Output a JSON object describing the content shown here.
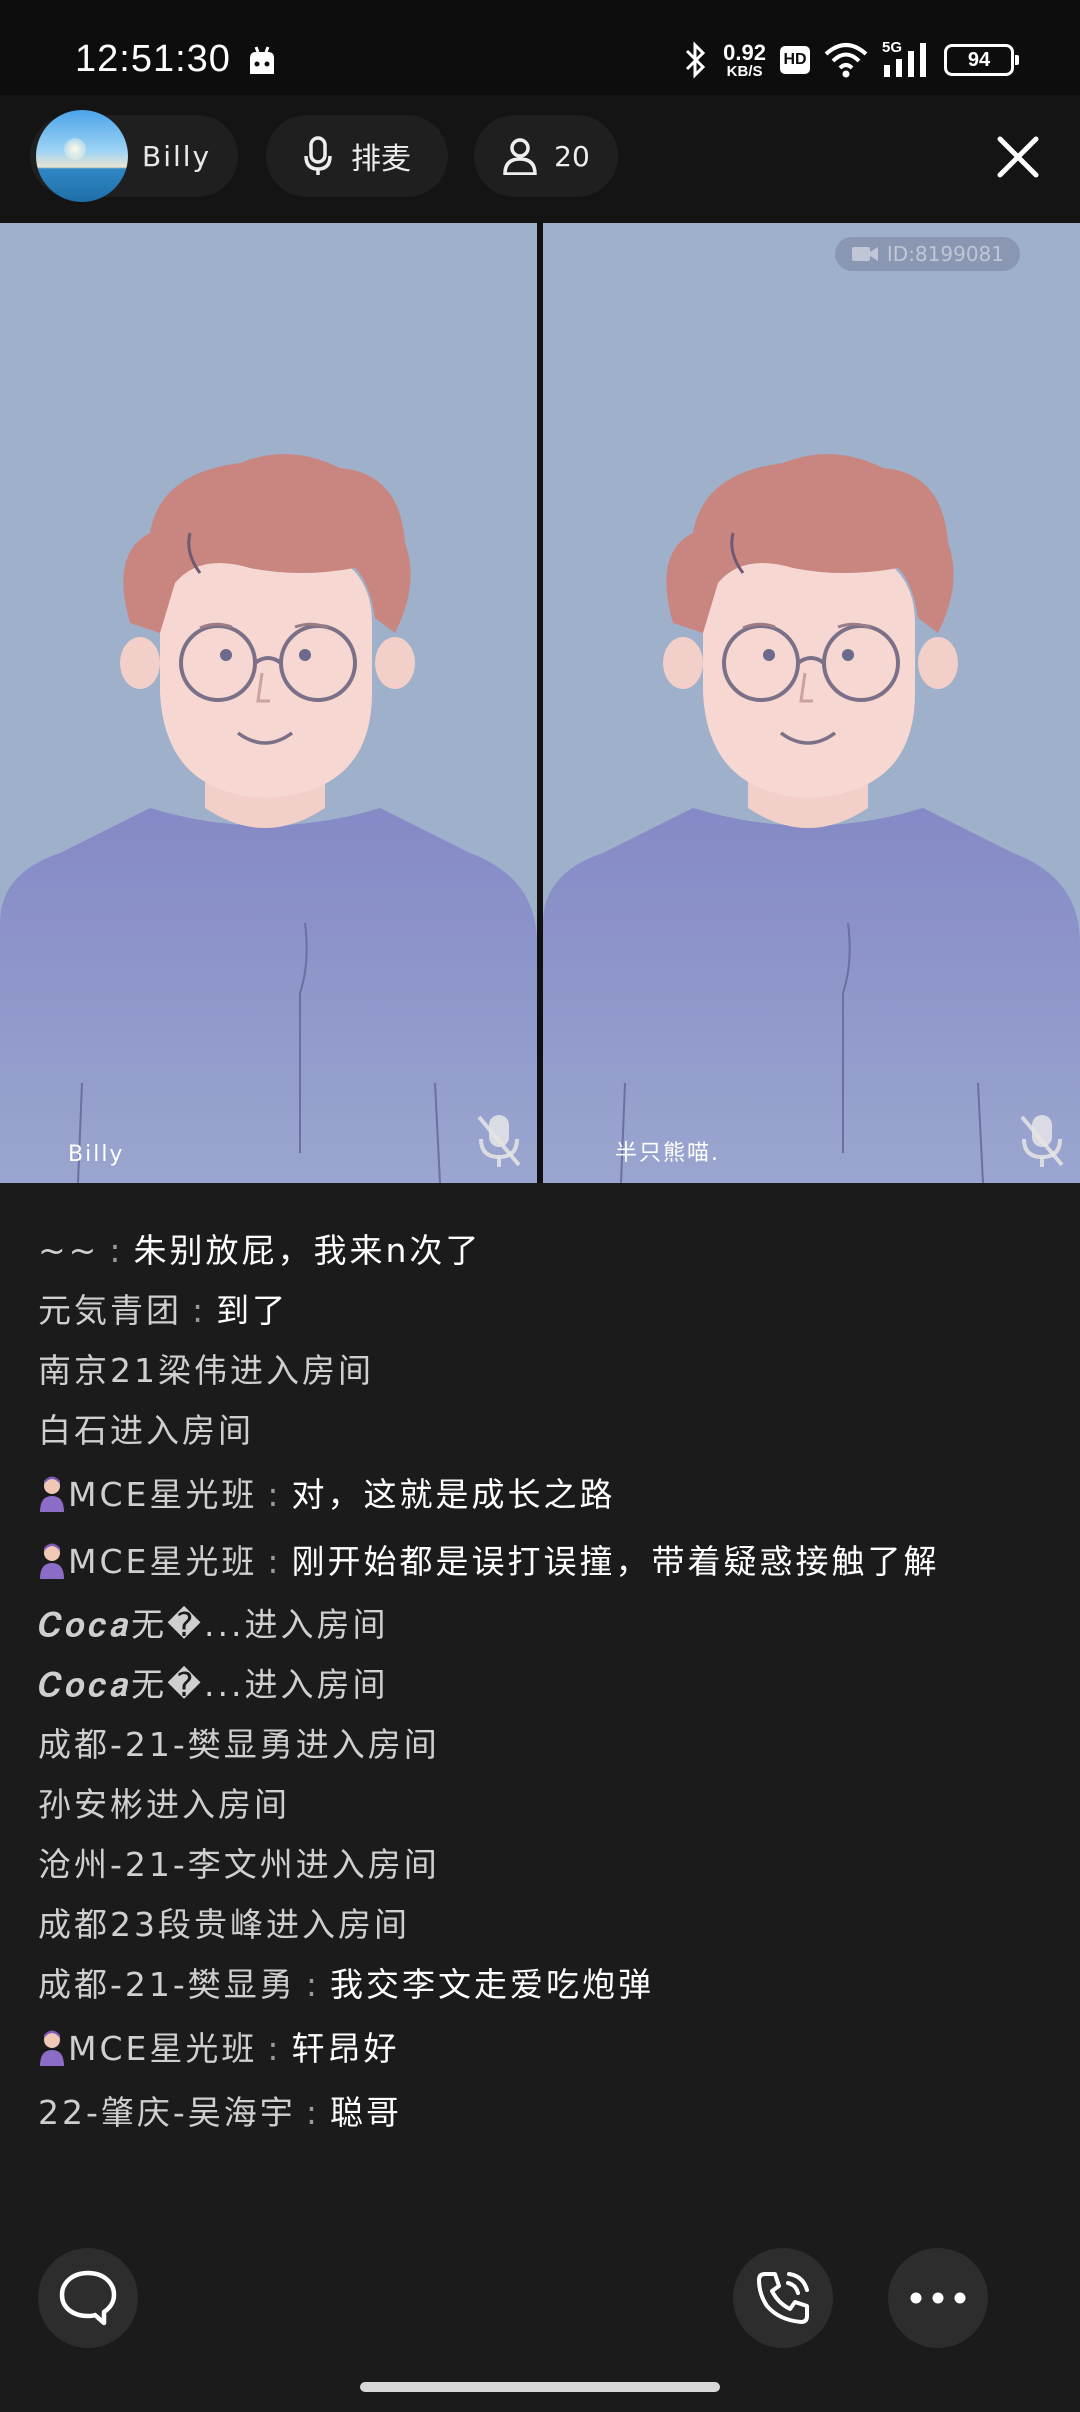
{
  "status_bar": {
    "time": "12:51:30",
    "network_speed_value": "0.92",
    "network_speed_unit": "KB/S",
    "hd_label": "HD",
    "signal_label": "5G",
    "battery": "94"
  },
  "room": {
    "host_name": "Billy",
    "queue_label": "排麦",
    "audience_count": "20"
  },
  "video": {
    "room_id": "ID:8199081",
    "tiles": [
      {
        "name": "Billy",
        "muted": true
      },
      {
        "name": "半只熊喵.",
        "muted": true
      }
    ]
  },
  "chat": {
    "separator": ":",
    "messages": [
      {
        "sender": "~~",
        "text": "朱别放屁，我来n次了",
        "badge": false,
        "system": false
      },
      {
        "sender": "元気青团",
        "text": "到了",
        "badge": false,
        "system": false
      },
      {
        "sender": "南京21梁伟进入房间",
        "text": "",
        "badge": false,
        "system": true
      },
      {
        "sender": "白石进入房间",
        "text": "",
        "badge": false,
        "system": true
      },
      {
        "sender": "MCE星光班",
        "text": "对，这就是成长之路",
        "badge": true,
        "system": false
      },
      {
        "sender": "MCE星光班",
        "text": "刚开始都是误打误撞，带着疑惑接触了解",
        "badge": true,
        "system": false
      },
      {
        "sender": "𝑪𝒐𝒄𝒂无�...进入房间",
        "text": "",
        "badge": false,
        "system": true
      },
      {
        "sender": "𝑪𝒐𝒄𝒂无�...进入房间",
        "text": "",
        "badge": false,
        "system": true
      },
      {
        "sender": "成都-21-樊显勇进入房间",
        "text": "",
        "badge": false,
        "system": true
      },
      {
        "sender": "孙安彬进入房间",
        "text": "",
        "badge": false,
        "system": true
      },
      {
        "sender": "沧州-21-李文州进入房间",
        "text": "",
        "badge": false,
        "system": true
      },
      {
        "sender": "成都23段贵峰进入房间",
        "text": "",
        "badge": false,
        "system": true
      },
      {
        "sender": "成都-21-樊显勇",
        "text": "我交李文走爱吃炮弹",
        "badge": false,
        "system": false
      },
      {
        "sender": "MCE星光班",
        "text": "轩昂好",
        "badge": true,
        "system": false
      },
      {
        "sender": "22-肇庆-吴海宇",
        "text": "聪哥",
        "badge": false,
        "system": false
      }
    ]
  },
  "colors": {
    "background": "#1b1b1b",
    "tile_background": "#9fb0cb",
    "hair": "#c98580",
    "shirt": "#8a8fc9"
  }
}
